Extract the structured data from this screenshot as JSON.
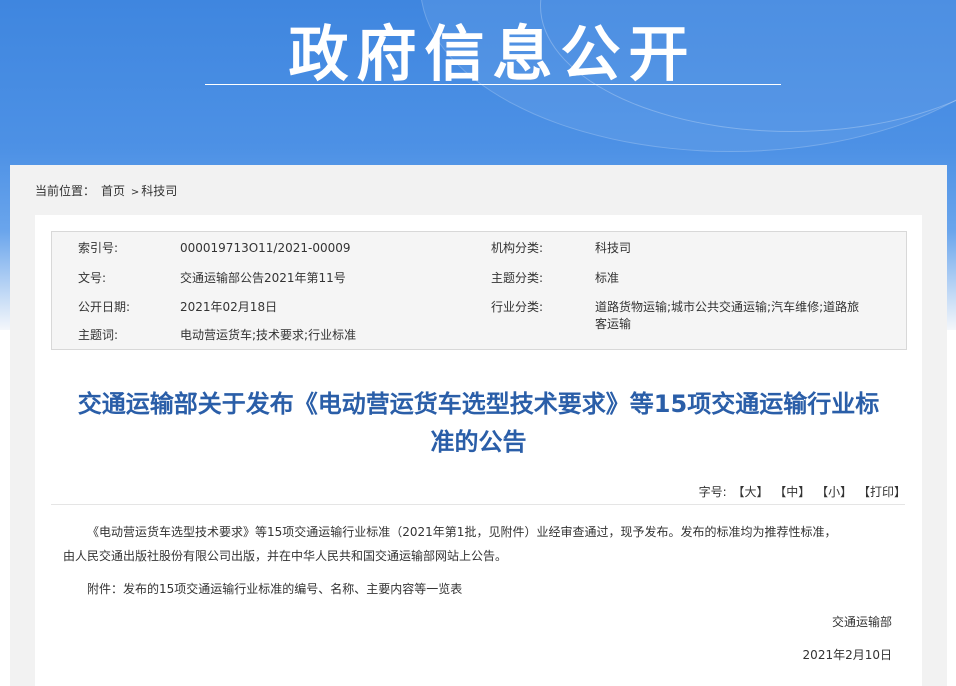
{
  "banner": {
    "title": "政府信息公开"
  },
  "breadcrumb": {
    "label": "当前位置：",
    "home": "首页",
    "sep": ">",
    "current": "科技司"
  },
  "meta": {
    "index_label": "索引号:",
    "index_value": "000019713O11/2021-00009",
    "org_label": "机构分类:",
    "org_value": "科技司",
    "doc_label": "文号:",
    "doc_value": "交通运输部公告2021年第11号",
    "topic_label": "主题分类:",
    "topic_value": "标准",
    "date_label": "公开日期:",
    "date_value": "2021年02月18日",
    "industry_label": "行业分类:",
    "industry_value_line1": "道路货物运输;城市公共交通运输;汽车维修;道路旅",
    "industry_value_line2": "客运输",
    "keywords_label": "主题词:",
    "keywords_value": "电动营运货车;技术要求;行业标准"
  },
  "article": {
    "title_line1": "交通运输部关于发布《电动营运货车选型技术要求》等15项交通运输行业标",
    "title_line2": "准的公告",
    "font_label": "字号:",
    "font_large": "【大】",
    "font_medium": "【中】",
    "font_small": "【小】",
    "print": "【打印】",
    "body_line1": "《电动营运货车选型技术要求》等15项交通运输行业标准（2021年第1批，见附件）业经审查通过，现予发布。发布的标准均为推荐性标准，",
    "body_line2": "由人民交通出版社股份有限公司出版，并在中华人民共和国交通运输部网站上公告。",
    "attachment": "附件：发布的15项交通运输行业标准的编号、名称、主要内容等一览表",
    "signature": "交通运输部",
    "sign_date": "2021年2月10日"
  }
}
